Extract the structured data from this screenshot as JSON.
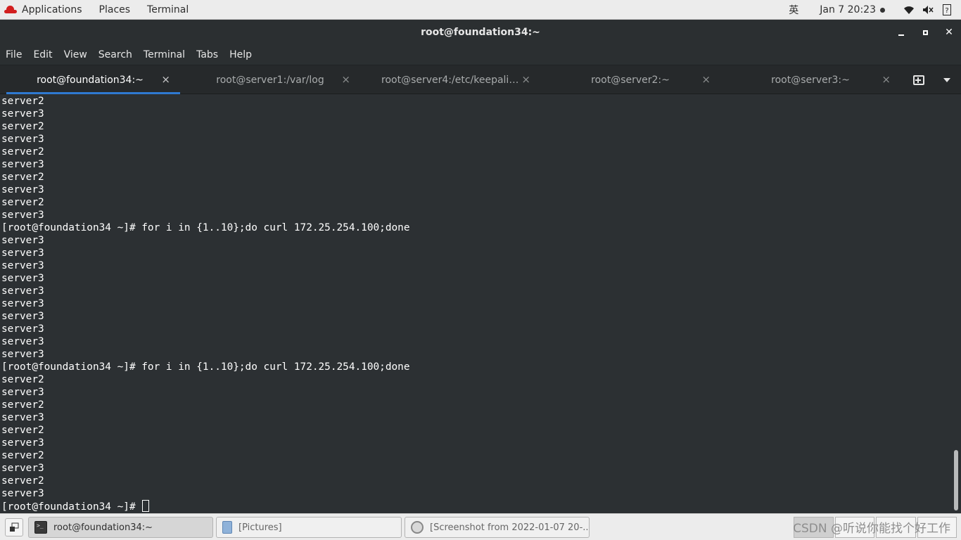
{
  "top_panel": {
    "applications": "Applications",
    "places": "Places",
    "terminal": "Terminal",
    "ime": "英",
    "clock": "Jan 7  20:23",
    "icons": [
      "wifi-icon",
      "volume-icon",
      "help-icon"
    ]
  },
  "window": {
    "title": "root@foundation34:~",
    "minimize": "minimize",
    "maximize": "maximize",
    "close": "✕"
  },
  "menubar": {
    "items": [
      "File",
      "Edit",
      "View",
      "Search",
      "Terminal",
      "Tabs",
      "Help"
    ]
  },
  "tabs": [
    {
      "label": "root@foundation34:~",
      "active": true
    },
    {
      "label": "root@server1:/var/log",
      "active": false
    },
    {
      "label": "root@server4:/etc/keepaliv...",
      "active": false
    },
    {
      "label": "root@server2:~",
      "active": false
    },
    {
      "label": "root@server3:~",
      "active": false
    }
  ],
  "tab_close": "×",
  "terminal": {
    "lines": [
      "server2",
      "server3",
      "server2",
      "server3",
      "server2",
      "server3",
      "server2",
      "server3",
      "server2",
      "server3",
      "[root@foundation34 ~]# for i in {1..10};do curl 172.25.254.100;done",
      "server3",
      "server3",
      "server3",
      "server3",
      "server3",
      "server3",
      "server3",
      "server3",
      "server3",
      "server3",
      "[root@foundation34 ~]# for i in {1..10};do curl 172.25.254.100;done",
      "server2",
      "server3",
      "server2",
      "server3",
      "server2",
      "server3",
      "server2",
      "server3",
      "server2",
      "server3"
    ],
    "prompt": "[root@foundation34 ~]# "
  },
  "taskbar": {
    "tasks": [
      {
        "label": "root@foundation34:~",
        "icon": "terminal-icon",
        "active": true
      },
      {
        "label": "[Pictures]",
        "icon": "files-icon",
        "active": false
      },
      {
        "label": "[Screenshot from 2022-01-07 20-...",
        "icon": "screenshot-icon",
        "active": false
      }
    ],
    "watermark": "CSDN @听说你能找个好工作"
  }
}
